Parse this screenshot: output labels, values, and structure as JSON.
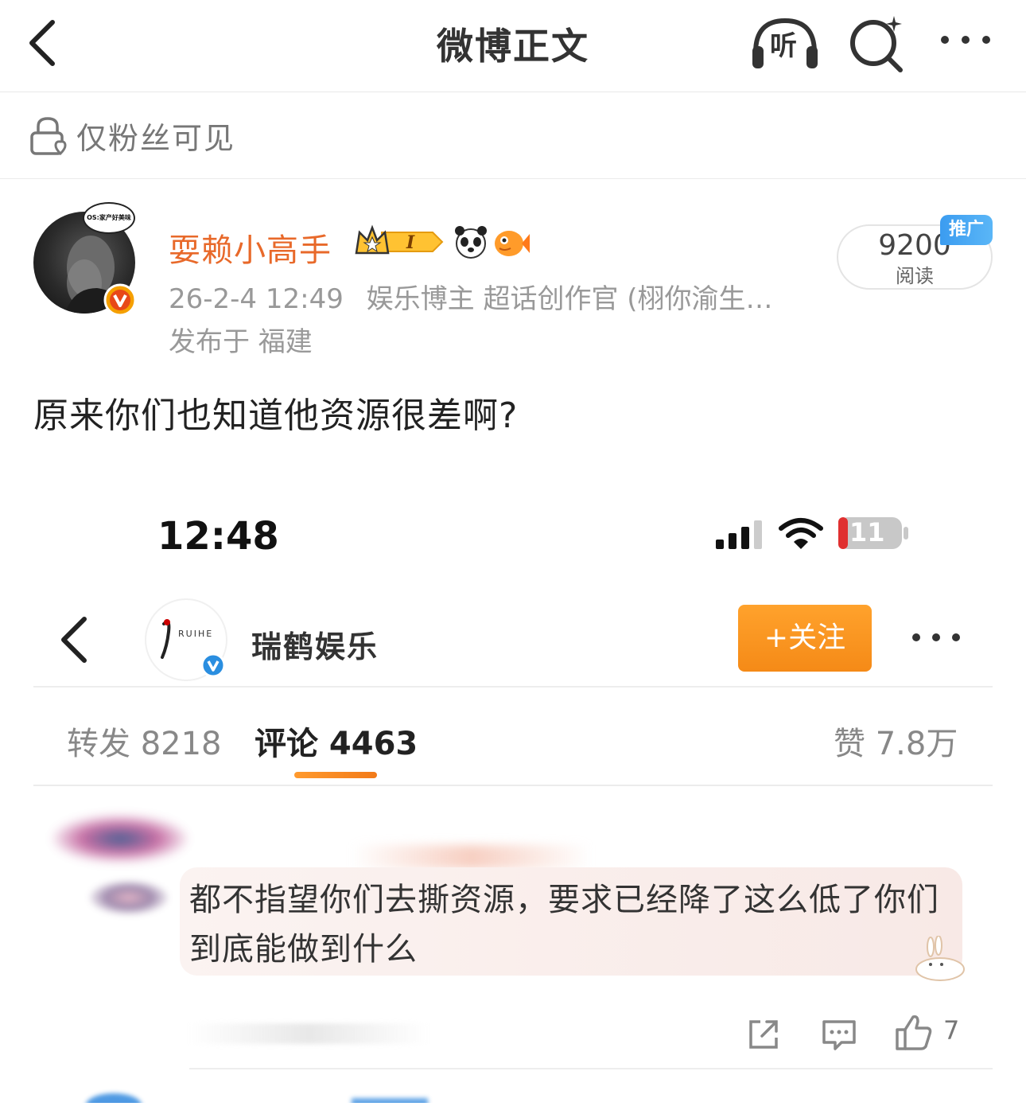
{
  "header": {
    "title": "微博正文",
    "listen_label": "听"
  },
  "visibility": {
    "text": "仅粉丝可见"
  },
  "author": {
    "name": "耍赖小高手",
    "avatar_bubble_text": "OS:家产好美味",
    "timestamp": "26-2-4 12:49",
    "tag": "娱乐博主 超话创作官 (栩你渝生…",
    "location": "发布于 福建"
  },
  "read_stats": {
    "count": "9200",
    "label": "阅读",
    "promo_label": "推广"
  },
  "post": {
    "text": "原来你们也知道他资源很差啊?"
  },
  "embedded": {
    "status_time": "12:48",
    "battery_level": "11",
    "account_name": "瑞鹤娱乐",
    "account_logo_text": "RUIHE",
    "follow_label": "+关注",
    "tabs": {
      "repost": "转发 8218",
      "comment": "评论 4463",
      "like": "赞 7.8万"
    },
    "comment_text": "都不指望你们去撕资源，要求已经降了这么低了你们到底能做到什么",
    "comment_like_count": "7"
  },
  "colors": {
    "accent_orange": "#e8692a",
    "follow_orange": "#f58a17",
    "promo_blue": "#3b9cf0",
    "verified_orange": "#f5a000",
    "verified_blue": "#2a8ee0"
  }
}
